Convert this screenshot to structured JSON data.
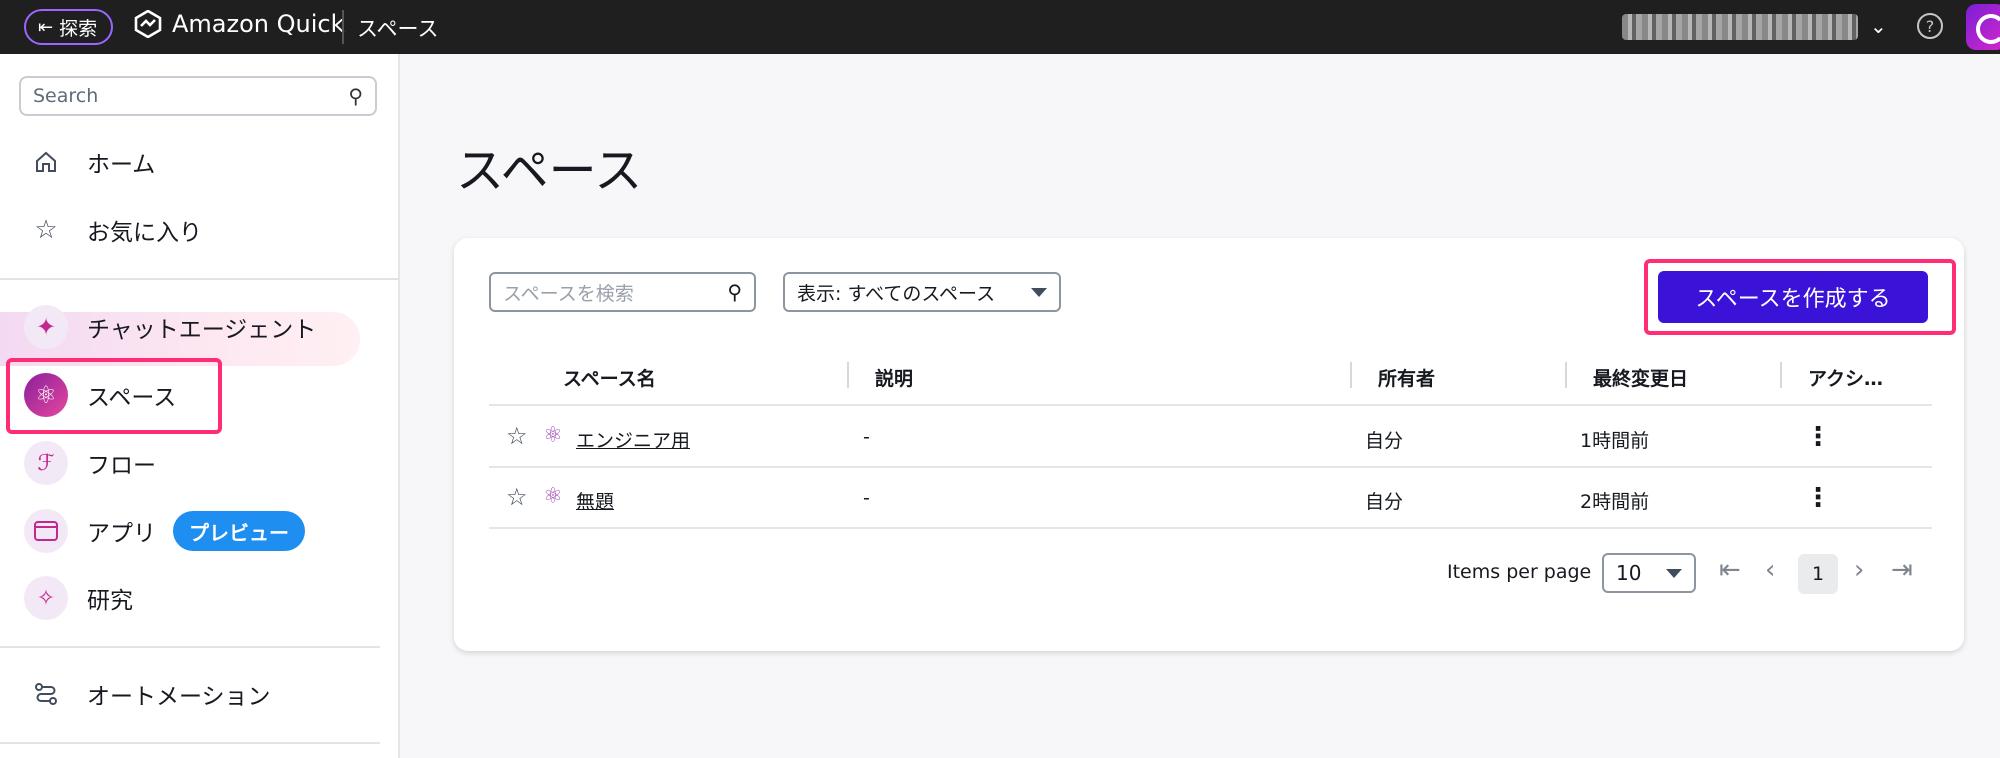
{
  "topbar": {
    "explore_label": "探索",
    "brand": "Amazon Quick",
    "breadcrumb": "スペース"
  },
  "sidebar": {
    "search_placeholder": "Search",
    "items": [
      {
        "label": "ホーム"
      },
      {
        "label": "お気に入り"
      },
      {
        "label": "チャットエージェント"
      },
      {
        "label": "スペース"
      },
      {
        "label": "フロー"
      },
      {
        "label": "アプリ",
        "badge": "プレビュー"
      },
      {
        "label": "研究"
      },
      {
        "label": "オートメーション"
      }
    ]
  },
  "main": {
    "title": "スペース",
    "search_placeholder": "スペースを検索",
    "filter_label": "表示: すべてのスペース",
    "create_button": "スペースを作成する",
    "columns": [
      "スペース名",
      "説明",
      "所有者",
      "最終変更日",
      "アクシ…"
    ],
    "rows": [
      {
        "name": "エンジニア用",
        "description": "-",
        "owner": "自分",
        "modified": "1時間前"
      },
      {
        "name": "無題",
        "description": "-",
        "owner": "自分",
        "modified": "2時間前"
      }
    ],
    "pagination": {
      "items_per_page_label": "Items per page",
      "items_per_page": "10",
      "current_page": "1"
    }
  },
  "colors": {
    "accent": "#3b12d8",
    "highlight": "#ff2d73",
    "badge": "#1f8ef1",
    "topbar": "#1f1f1f"
  }
}
